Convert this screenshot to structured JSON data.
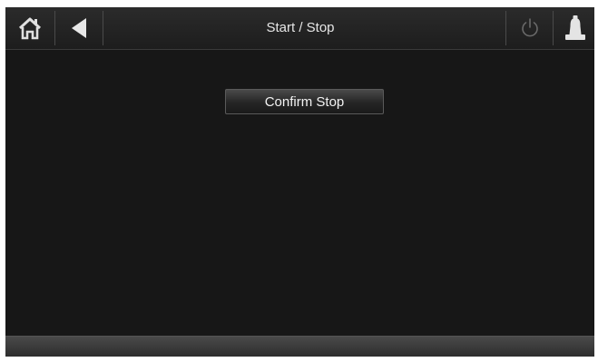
{
  "header": {
    "title": "Start / Stop",
    "home_icon": "home-icon",
    "back_icon": "back-arrow-icon",
    "power_icon": "power-icon",
    "alarm_icon": "alarm-bell-icon"
  },
  "main": {
    "confirm_stop_label": "Confirm Stop"
  },
  "colors": {
    "background": "#171717",
    "text": "#e6e6e6"
  }
}
